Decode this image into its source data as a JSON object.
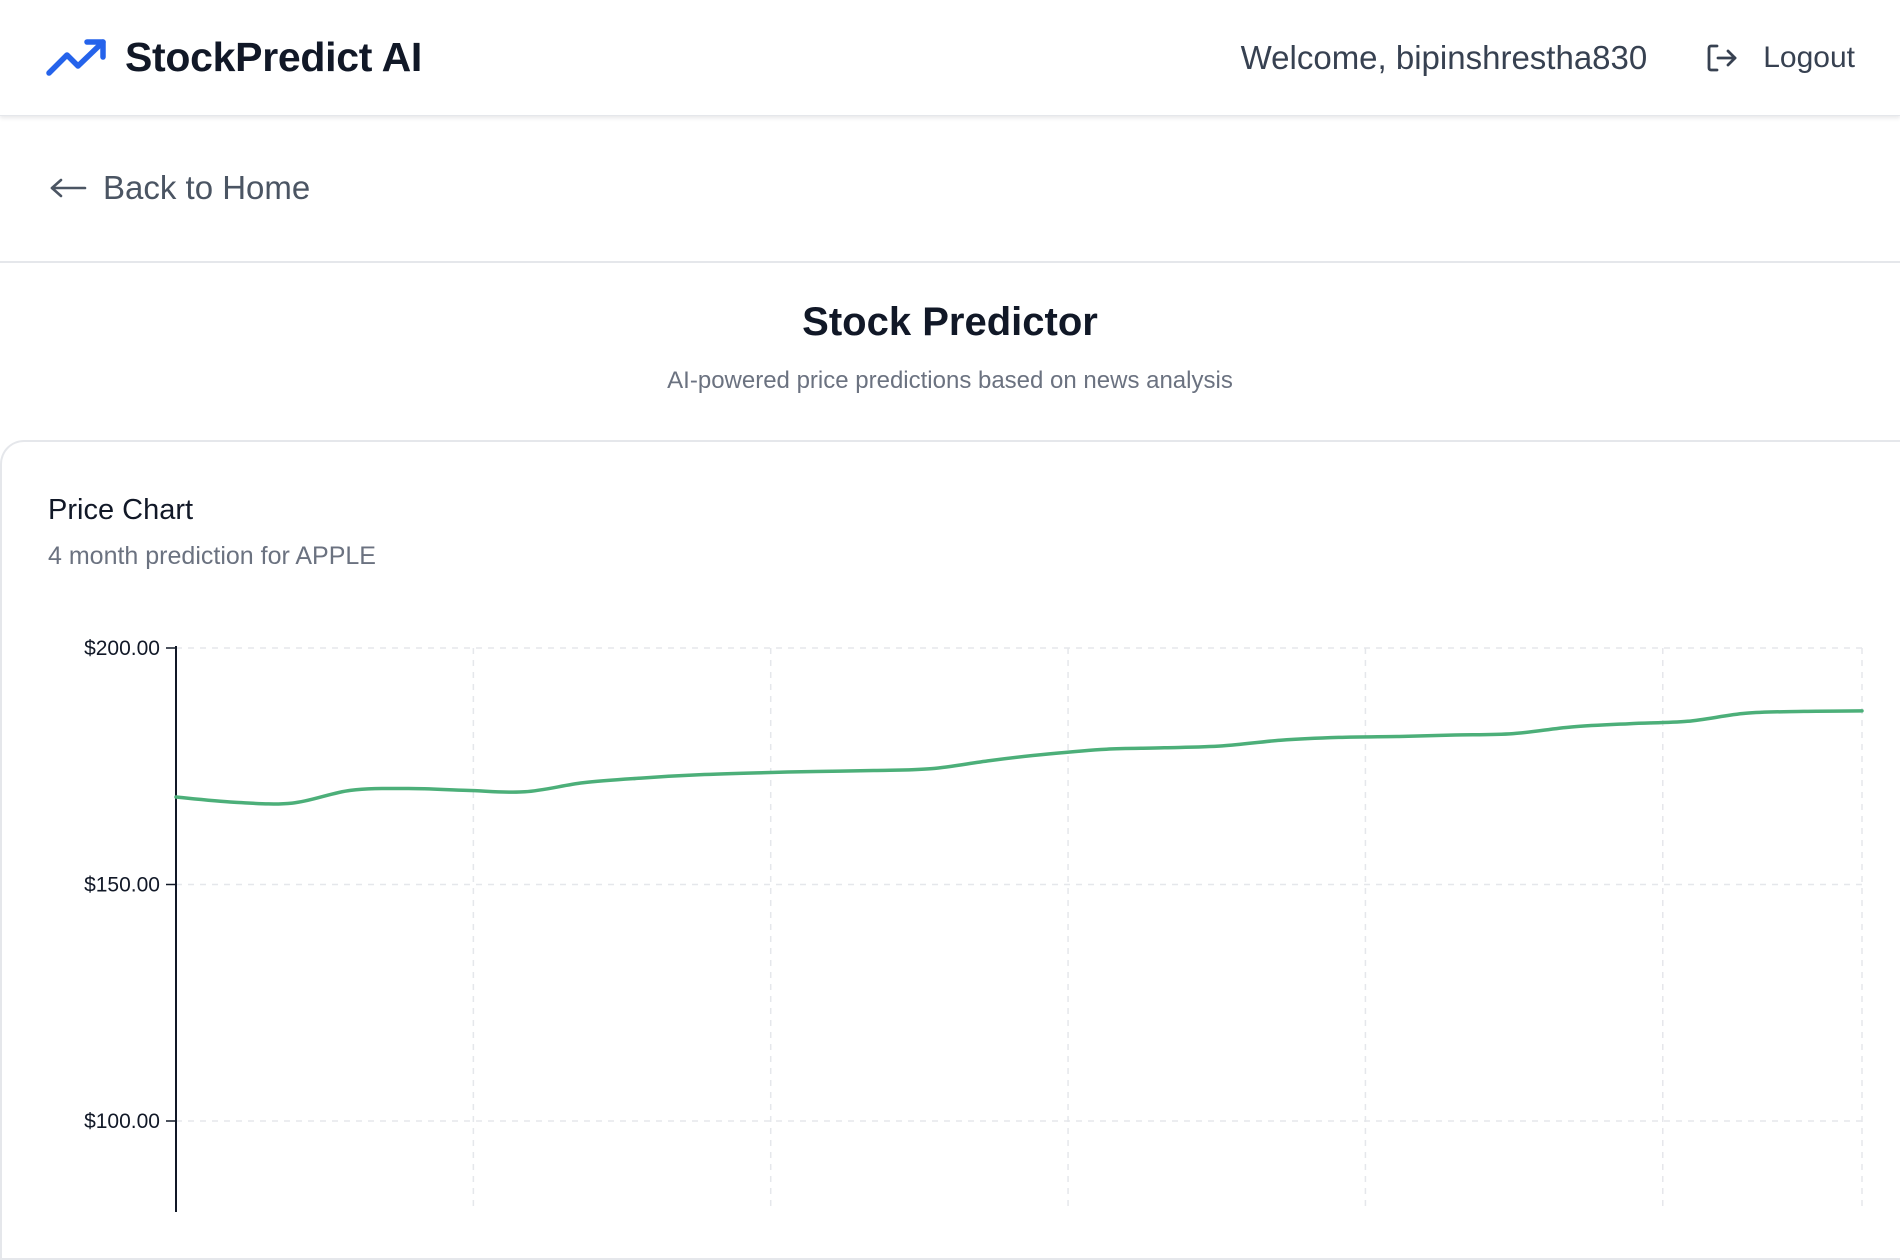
{
  "header": {
    "brand": "StockPredict AI",
    "brand_icon": "trending-up-icon",
    "welcome": "Welcome, bipinshrestha830",
    "logout_icon": "logout-icon",
    "logout_label": "Logout"
  },
  "nav": {
    "back_icon": "arrow-left-icon",
    "back_label": "Back to Home"
  },
  "page": {
    "title": "Stock Predictor",
    "subtitle": "AI-powered price predictions based on news analysis"
  },
  "card": {
    "title": "Price Chart",
    "subtitle": "4 month prediction for APPLE"
  },
  "colors": {
    "accent": "#2563eb",
    "line": "#4caf79",
    "grid": "#e5e7eb",
    "text_dark": "#111827",
    "text_muted": "#6b7280"
  },
  "chart_data": {
    "type": "line",
    "ylim": [
      80,
      200
    ],
    "y_ticks": [
      200,
      150,
      100
    ],
    "y_tick_labels": [
      "$200.00",
      "$150.00",
      "$100.00"
    ],
    "grid": true,
    "series": [
      {
        "values": [
          168.5,
          167.4,
          167.2,
          169.9,
          170.3,
          169.9,
          169.6,
          171.5,
          172.5,
          173.2,
          173.6,
          173.9,
          174.1,
          174.5,
          176.2,
          177.6,
          178.6,
          178.9,
          179.3,
          180.5,
          181.1,
          181.3,
          181.6,
          181.9,
          183.3,
          184.0,
          184.5,
          186.2,
          186.6,
          186.7
        ]
      }
    ]
  }
}
